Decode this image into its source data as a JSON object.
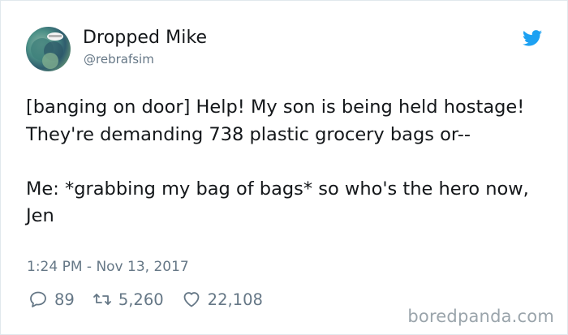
{
  "tweet": {
    "display_name": "Dropped Mike",
    "handle": "@rebrafsim",
    "text": "[banging on door] Help! My son is being held hostage! They're demanding 738 plastic grocery bags or--\n\nMe: *grabbing my bag of bags* so who's the hero now, Jen",
    "timestamp": "1:24 PM - Nov 13, 2017",
    "replies": "89",
    "retweets": "5,260",
    "likes": "22,108"
  },
  "icons": {
    "platform": "twitter-bird-icon",
    "reply": "reply-icon",
    "retweet": "retweet-icon",
    "like": "heart-icon"
  },
  "colors": {
    "twitter_blue": "#1da1f2",
    "secondary_text": "#657786",
    "primary_text": "#14171a"
  },
  "watermark": "boredpanda.com"
}
